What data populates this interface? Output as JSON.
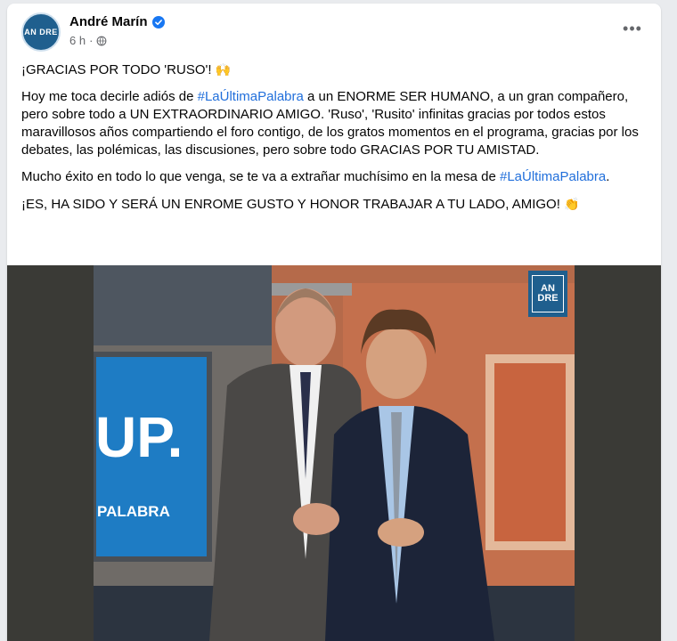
{
  "post": {
    "author": "André Marín",
    "time": "6 h",
    "avatar_text": "AN DRE",
    "more_label": "•••",
    "lines": {
      "p1": "¡GRACIAS POR TODO 'RUSO'! ",
      "p1_emoji": "🙌",
      "p2_a": "Hoy me toca decirle adiós de ",
      "p2_tag": "#LaÚltimaPalabra",
      "p2_b": " a un ENORME SER HUMANO, a un gran compañero, pero sobre todo a UN EXTRAORDINARIO AMIGO. 'Ruso', 'Rusito' infinitas gracias por todos estos maravillosos años compartiendo el foro contigo, de los gratos momentos en el programa, gracias por los debates, las polémicas, las discusiones, pero sobre todo GRACIAS POR TU AMISTAD.",
      "p3_a": "Mucho éxito en todo lo que venga, se te va a extrañar muchísimo en la mesa de ",
      "p3_tag": "#LaÚltimaPalabra",
      "p3_b": ".",
      "p4": "¡ES, HA SIDO Y SERÁ UN ENROME GUSTO Y HONOR TRABAJAR A TU LADO, AMIGO! ",
      "p4_emoji": "👏"
    },
    "photo": {
      "logo_text": "AN DRE",
      "screen_big": "UP.",
      "screen_small": "PALABRA"
    }
  },
  "colors": {
    "link": "#216fdb",
    "brand": "#1f5f8e",
    "studio_blue": "#1e7cc4"
  }
}
